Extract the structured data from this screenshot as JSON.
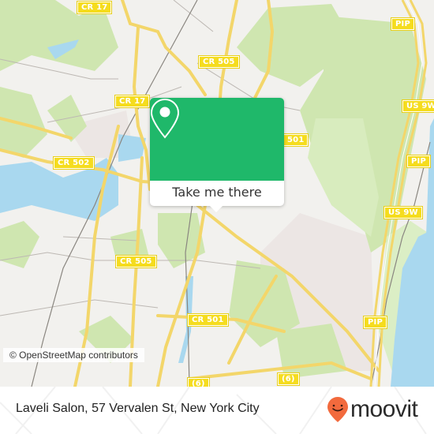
{
  "map": {
    "road_labels": [
      {
        "id": "cr17-top",
        "text": "CR 17"
      },
      {
        "id": "cr17-mid",
        "text": "CR 17"
      },
      {
        "id": "cr505-top",
        "text": "CR 505"
      },
      {
        "id": "cr502",
        "text": "CR 502"
      },
      {
        "id": "cr501-right",
        "text": "501"
      },
      {
        "id": "cr505-mid",
        "text": "CR 505"
      },
      {
        "id": "cr501-bottom",
        "text": "CR 501"
      },
      {
        "id": "pip-top",
        "text": "PIP"
      },
      {
        "id": "us9w-top",
        "text": "US 9W"
      },
      {
        "id": "pip-mid",
        "text": "PIP"
      },
      {
        "id": "us9w-mid",
        "text": "US 9W"
      },
      {
        "id": "pip-bottom",
        "text": "PIP"
      },
      {
        "id": "r6-left",
        "text": "(6)"
      },
      {
        "id": "r6-right",
        "text": "(6)"
      }
    ],
    "attribution": "© OpenStreetMap contributors",
    "colors": {
      "land": "#f2f1ee",
      "park": "#cfe6b0",
      "water": "#a9d8ef",
      "road": "#f7e27a",
      "urban": "#ece6e4"
    }
  },
  "popup": {
    "icon": "location-pin-icon",
    "button_label": "Take me there",
    "color": "#1fb86a"
  },
  "footer": {
    "place_name": "Laveli Salon, 57 Vervalen St, New York City",
    "brand": "moovit",
    "brand_color": "#f26a3d"
  }
}
